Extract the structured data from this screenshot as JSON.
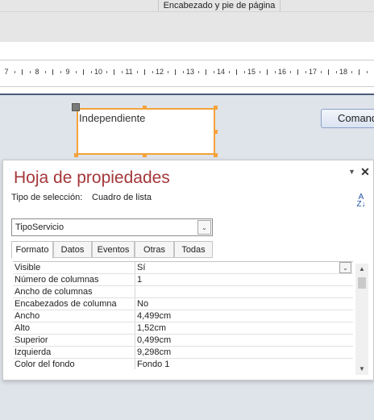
{
  "ribbon": {
    "group_label": "Encabezado y pie de página"
  },
  "ruler": {
    "numbers": [
      "7",
      "8",
      "9",
      "10",
      "11",
      "12",
      "13",
      "14",
      "15",
      "16",
      "17",
      "18"
    ]
  },
  "canvas": {
    "textbox_label": "Independiente",
    "command_button_label": "Comando"
  },
  "property_sheet": {
    "title": "Hoja de propiedades",
    "selection_type_label": "Tipo de selección:",
    "selection_type_value": "Cuadro de lista",
    "sort_icon": "sort-az-icon",
    "object_combo_value": "TipoServicio",
    "tabs": [
      "Formato",
      "Datos",
      "Eventos",
      "Otras",
      "Todas"
    ],
    "active_tab": "Formato",
    "properties": [
      {
        "label": "Visible",
        "value": "Sí"
      },
      {
        "label": "Número de columnas",
        "value": "1"
      },
      {
        "label": "Ancho de columnas",
        "value": ""
      },
      {
        "label": "Encabezados de columna",
        "value": "No"
      },
      {
        "label": "Ancho",
        "value": "4,499cm"
      },
      {
        "label": "Alto",
        "value": "1,52cm"
      },
      {
        "label": "Superior",
        "value": "0,499cm"
      },
      {
        "label": "Izquierda",
        "value": "9,298cm"
      },
      {
        "label": "Color del fondo",
        "value": "Fondo 1"
      }
    ]
  },
  "colors": {
    "title_red": "#a4373a",
    "selection_orange": "#f4a23a",
    "canvas_bg": "#dfe3ea"
  }
}
